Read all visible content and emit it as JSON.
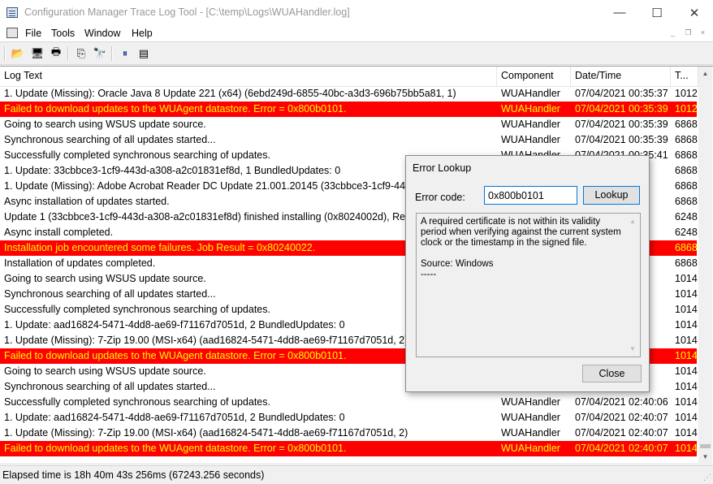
{
  "window": {
    "title": "Configuration Manager Trace Log Tool - [C:\\temp\\Logs\\WUAHandler.log]",
    "minimize": "—",
    "maximize": "☐",
    "close": "✕"
  },
  "menu": {
    "items": [
      "File",
      "Tools",
      "Window",
      "Help"
    ],
    "mdi_controls": [
      "_",
      "❐",
      "×"
    ]
  },
  "toolbar": {
    "buttons": [
      {
        "name": "open-icon",
        "glyph": "📂"
      },
      {
        "name": "computer-icon",
        "glyph": "🖥"
      },
      {
        "name": "print-icon",
        "glyph": "🖶"
      },
      {
        "name": "copy-icon",
        "glyph": "⎘"
      },
      {
        "name": "find-icon",
        "glyph": "🔭"
      },
      {
        "name": "pause-icon",
        "glyph": "⏸"
      },
      {
        "name": "columns-icon",
        "glyph": "▤"
      }
    ]
  },
  "columns": [
    "Log Text",
    "Component",
    "Date/Time",
    "T..."
  ],
  "rows": [
    {
      "text": "1. Update (Missing): Oracle Java 8 Update 221 (x64) (6ebd249d-6855-40bc-a3d3-696b75bb5a81, 1)",
      "component": "WUAHandler",
      "datetime": "07/04/2021 00:35:37",
      "thread": "1012",
      "error": false
    },
    {
      "text": "Failed to download updates to the WUAgent datastore. Error = 0x800b0101.",
      "component": "WUAHandler",
      "datetime": "07/04/2021 00:35:39",
      "thread": "1012",
      "error": true
    },
    {
      "text": "Going to search using WSUS update source.",
      "component": "WUAHandler",
      "datetime": "07/04/2021 00:35:39",
      "thread": "6868",
      "error": false
    },
    {
      "text": "Synchronous searching of all updates started...",
      "component": "WUAHandler",
      "datetime": "07/04/2021 00:35:39",
      "thread": "6868",
      "error": false
    },
    {
      "text": "Successfully completed synchronous searching of updates.",
      "component": "WUAHandler",
      "datetime": "07/04/2021 00:35:41",
      "thread": "6868",
      "error": false
    },
    {
      "text": "1. Update: 33cbbce3-1cf9-443d-a308-a2c01831ef8d, 1  BundledUpdates: 0",
      "component": "",
      "datetime": "",
      "thread": "6868",
      "error": false
    },
    {
      "text": "1. Update (Missing): Adobe Acrobat Reader DC Update 21.001.20145 (33cbbce3-1cf9-443d-a308-a2c01831ef8d, 1)",
      "component": "",
      "datetime": "",
      "thread": "6868",
      "error": false
    },
    {
      "text": "Async installation of updates started.",
      "component": "",
      "datetime": "",
      "thread": "6868",
      "error": false
    },
    {
      "text": "Update 1 (33cbbce3-1cf9-443d-a308-a2c01831ef8d) finished installing (0x8024002d), Reboot Required? No",
      "component": "",
      "datetime": "",
      "thread": "6248",
      "error": false
    },
    {
      "text": "Async install completed.",
      "component": "",
      "datetime": "",
      "thread": "6248",
      "error": false
    },
    {
      "text": "Installation job encountered some failures. Job Result = 0x80240022.",
      "component": "",
      "datetime": "",
      "thread": "6868",
      "error": true
    },
    {
      "text": "Installation of updates completed.",
      "component": "",
      "datetime": "",
      "thread": "6868",
      "error": false
    },
    {
      "text": "Going to search using WSUS update source.",
      "component": "",
      "datetime": "",
      "thread": "1014",
      "error": false
    },
    {
      "text": "Synchronous searching of all updates started...",
      "component": "",
      "datetime": "",
      "thread": "1014",
      "error": false
    },
    {
      "text": "Successfully completed synchronous searching of updates.",
      "component": "",
      "datetime": "",
      "thread": "1014",
      "error": false
    },
    {
      "text": "1. Update: aad16824-5471-4dd8-ae69-f71167d7051d, 2   BundledUpdates: 0",
      "component": "",
      "datetime": "",
      "thread": "1014",
      "error": false
    },
    {
      "text": "1. Update (Missing): 7-Zip 19.00 (MSI-x64) (aad16824-5471-4dd8-ae69-f71167d7051d, 2)",
      "component": "",
      "datetime": "",
      "thread": "1014",
      "error": false
    },
    {
      "text": "Failed to download updates to the WUAgent datastore. Error = 0x800b0101.",
      "component": "",
      "datetime": "",
      "thread": "1014",
      "error": true
    },
    {
      "text": "Going to search using WSUS update source.",
      "component": "",
      "datetime": "",
      "thread": "1014",
      "error": false
    },
    {
      "text": "Synchronous searching of all updates started...",
      "component": "",
      "datetime": "",
      "thread": "1014",
      "error": false
    },
    {
      "text": "Successfully completed synchronous searching of updates.",
      "component": "WUAHandler",
      "datetime": "07/04/2021 02:40:06",
      "thread": "1014",
      "error": false
    },
    {
      "text": "1. Update: aad16824-5471-4dd8-ae69-f71167d7051d, 2   BundledUpdates: 0",
      "component": "WUAHandler",
      "datetime": "07/04/2021 02:40:07",
      "thread": "1014",
      "error": false
    },
    {
      "text": "1. Update (Missing): 7-Zip 19.00 (MSI-x64) (aad16824-5471-4dd8-ae69-f71167d7051d, 2)",
      "component": "WUAHandler",
      "datetime": "07/04/2021 02:40:07",
      "thread": "1014",
      "error": false
    },
    {
      "text": "Failed to download updates to the WUAgent datastore. Error = 0x800b0101.",
      "component": "WUAHandler",
      "datetime": "07/04/2021 02:40:07",
      "thread": "1014",
      "error": true
    }
  ],
  "status": {
    "text": "Elapsed time is 18h 40m 43s 256ms (67243.256 seconds)"
  },
  "dialog": {
    "title": "Error Lookup",
    "label": "Error code:",
    "value": "0x800b0101",
    "lookup_label": "Lookup",
    "result_message": "A required certificate is not within its validity period when verifying against the current system clock or the timestamp in the signed file.",
    "result_source": "Source: Windows",
    "result_separator": "-----",
    "close_label": "Close"
  },
  "colors": {
    "error_row_bg": "#ff0000",
    "error_row_text": "#ffff00",
    "accent": "#0078d7"
  }
}
